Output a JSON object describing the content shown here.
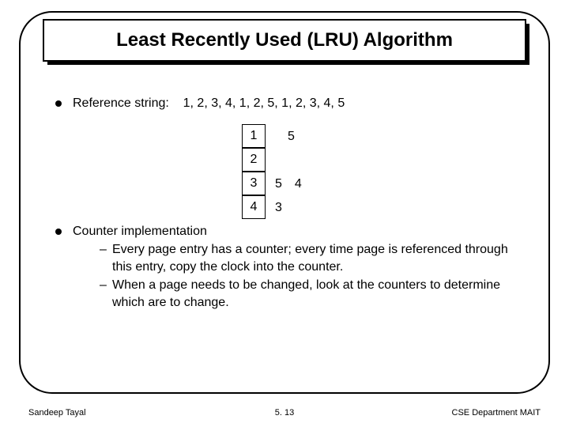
{
  "title": "Least Recently Used (LRU) Algorithm",
  "bullet1_label": "Reference string:",
  "bullet1_values": "1, 2, 3, 4, 1, 2, 5, 1, 2, 3, 4, 5",
  "frames": {
    "r1_cell": "1",
    "r1_side_a": "",
    "r1_side_b": "5",
    "r2_cell": "2",
    "r2_side_a": "",
    "r2_side_b": "",
    "r3_cell": "3",
    "r3_side_a": "5",
    "r3_side_b": "4",
    "r4_cell": "4",
    "r4_side_a": "3",
    "r4_side_b": ""
  },
  "bullet2_label": "Counter implementation",
  "dash1": "Every page entry has a counter; every time page is referenced through this entry, copy the clock into the counter.",
  "dash2": "When a page needs to be changed, look at the counters to determine which are to change.",
  "footer_left": "Sandeep Tayal",
  "footer_mid": "5. 13",
  "footer_right": "CSE Department MAIT"
}
